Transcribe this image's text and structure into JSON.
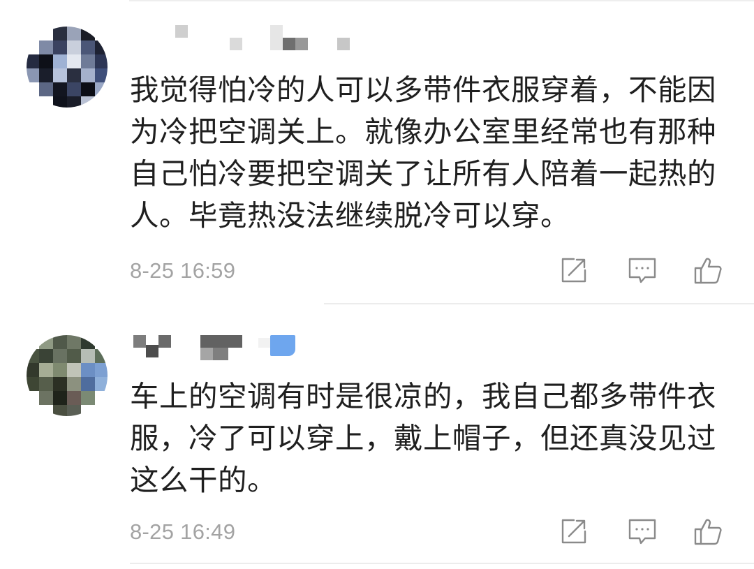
{
  "comments": [
    {
      "text": "我觉得怕冷的人可以多带件衣服穿着，不能因为冷把空调关上。就像办公室里经常也有那种自己怕冷要把空调关了让所有人陪着一起热的人。毕竟热没法继续脱冷可以穿。",
      "timestamp": "8-25 16:59",
      "actions": {
        "repost_icon": "repost-icon",
        "comment_icon": "comment-icon",
        "like_icon": "thumbs-up-icon"
      }
    },
    {
      "text": "车上的空调有时是很凉的，我自己都多带件衣服，冷了可以穿上，戴上帽子，但还真没见过这么干的。",
      "timestamp": "8-25 16:49",
      "actions": {
        "repost_icon": "repost-icon",
        "comment_icon": "comment-icon",
        "like_icon": "thumbs-up-icon"
      }
    }
  ],
  "colors": {
    "text": "#1f1f1f",
    "muted": "#a3a3a3",
    "icon": "#8a8a8a",
    "divider": "#ececec",
    "badge_blue": "#6ea6ee"
  }
}
